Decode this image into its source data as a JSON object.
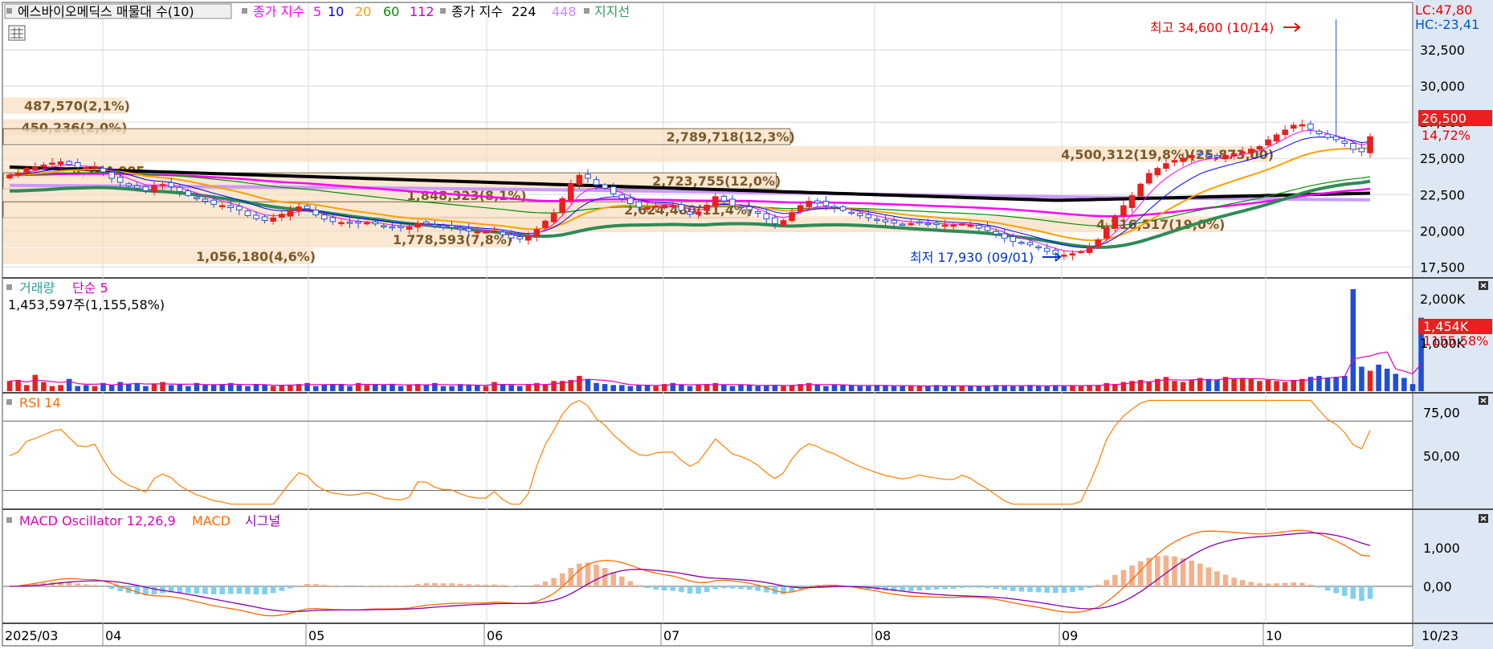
{
  "legend": {
    "stock": "에스바이오메딕스 매물대 수(10)",
    "ma_label": "종가 지수",
    "ma_periods": [
      {
        "v": "5",
        "color": "#ff00ff"
      },
      {
        "v": "10",
        "color": "#0000ff"
      },
      {
        "v": "20",
        "color": "#ffa000"
      },
      {
        "v": "60",
        "color": "#009000"
      },
      {
        "v": "112",
        "color": "#cc00cc"
      }
    ],
    "long_label": "종가 지수",
    "long_periods": [
      {
        "v": "224",
        "color": "#000000"
      },
      {
        "v": "448",
        "color": "#cc88ff"
      }
    ],
    "support": "지지선"
  },
  "right_info": {
    "lc": "LC:47,80",
    "hc": "HC:-23,41"
  },
  "price_badge": {
    "price": "26,500",
    "pct": "14,72%"
  },
  "price_annotations": {
    "high": "최고 34,600 (10/14)",
    "low": "최저 17,930 (09/01)"
  },
  "volume_panel": {
    "title": "거래량",
    "ma": "단순 5",
    "current": "1,453,597주(1,155,58%)",
    "badge_value": "1,454K",
    "badge_pct": "1155,58%"
  },
  "rsi_panel": {
    "title": "RSI 14"
  },
  "macd_panel": {
    "title": "MACD Oscillator 12,26,9",
    "macd": "MACD",
    "signal": "시그널"
  },
  "chart_data": {
    "type": "candlestick",
    "x_labels": [
      "2025/03",
      "04",
      "05",
      "06",
      "07",
      "08",
      "09",
      "10",
      "10/23"
    ],
    "price_axis": {
      "ylim": [
        16800,
        35500
      ],
      "ticks": [
        "17,500",
        "20,000",
        "22,500",
        "25,000",
        "27,500",
        "30,000",
        "32,500"
      ]
    },
    "high": {
      "value": 34600,
      "date": "10/14"
    },
    "low": {
      "value": 17930,
      "date": "09/01"
    },
    "last_close": 26500,
    "volume_profile": [
      {
        "price": 28650,
        "label": "487,570(2,1%)",
        "len": 0.087
      },
      {
        "price": 27150,
        "label": "450,236(2,0%)",
        "len": 0.085
      },
      {
        "price": 26500,
        "label": "2,789,718(12,3%)",
        "len": 0.56
      },
      {
        "price": 25300,
        "label": "4,500,312(19,8%)(25,873,00)",
        "len": 0.9
      },
      {
        "price": 24150,
        "label": "4,764,005",
        "len": 0.1
      },
      {
        "price": 23450,
        "label": "2,723,755(12,0%)",
        "len": 0.55
      },
      {
        "price": 22450,
        "label": "1,848,323(8,1%)",
        "len": 0.37
      },
      {
        "price": 21450,
        "label": "2,624,480(11,4%)",
        "len": 0.53
      },
      {
        "price": 20450,
        "label": "4,316,517(19,0%)",
        "len": 0.866
      },
      {
        "price": 19400,
        "label": "1,778,593(7,8%)",
        "len": 0.36
      },
      {
        "price": 18250,
        "label": "1,056,180(4,6%)",
        "len": 0.22
      }
    ],
    "volume_axis": {
      "ticks": [
        "1,000K",
        "2,000K"
      ]
    },
    "rsi_axis": {
      "ticks": [
        "50,00",
        "75,00"
      ],
      "upper": 70,
      "lower": 30
    },
    "macd_axis": {
      "ticks": [
        "0,00",
        "1,000"
      ]
    },
    "closes": [
      23850,
      23960,
      24310,
      24410,
      24540,
      24680,
      24760,
      24580,
      24390,
      24370,
      24440,
      24070,
      23620,
      23350,
      23110,
      22950,
      22770,
      23090,
      23200,
      23050,
      22710,
      22440,
      22210,
      22040,
      21830,
      21740,
      21600,
      21440,
      21050,
      20840,
      20710,
      20890,
      21140,
      21400,
      21650,
      21530,
      21100,
      20810,
      20640,
      20570,
      20510,
      20530,
      20560,
      20480,
      20310,
      20240,
      20210,
      20250,
      20510,
      20490,
      20320,
      20240,
      20230,
      20090,
      19980,
      19930,
      19930,
      20010,
      19730,
      19500,
      19430,
      19600,
      20090,
      20670,
      21240,
      22220,
      23210,
      23830,
      23630,
      23180,
      22940,
      22550,
      22230,
      21880,
      21630,
      21580,
      21710,
      21750,
      21740,
      21410,
      21140,
      21300,
      21770,
      22360,
      22060,
      21730,
      21620,
      21450,
      21210,
      20830,
      20490,
      20700,
      21260,
      21740,
      22040,
      21920,
      21730,
      21610,
      21410,
      21230,
      21040,
      20900,
      20750,
      20620,
      20540,
      20460,
      20500,
      20560,
      20490,
      20440,
      20400,
      20390,
      20470,
      20380,
      20190,
      20020,
      19770,
      19480,
      19260,
      19140,
      19030,
      18820,
      18580,
      18390,
      18320,
      18420,
      18570,
      18900,
      19370,
      20230,
      20980,
      21730,
      22430,
      23220,
      23960,
      24310,
      24640,
      24860,
      25020,
      25210,
      25300,
      25150,
      25090,
      25210,
      25330,
      25450,
      25640,
      25820,
      26280,
      26620,
      26960,
      27290,
      27330,
      27010,
      26700,
      26440,
      26290,
      26040,
      25620,
      25460,
      26500
    ],
    "volumes": [
      0.1,
      0.11,
      0.06,
      0.16,
      0.09,
      0.05,
      0.06,
      0.12,
      0.05,
      0.06,
      0.05,
      0.08,
      0.06,
      0.09,
      0.07,
      0.08,
      0.05,
      0.07,
      0.09,
      0.06,
      0.07,
      0.05,
      0.08,
      0.06,
      0.06,
      0.07,
      0.08,
      0.06,
      0.05,
      0.07,
      0.06,
      0.05,
      0.06,
      0.06,
      0.07,
      0.08,
      0.05,
      0.06,
      0.07,
      0.07,
      0.05,
      0.08,
      0.06,
      0.07,
      0.06,
      0.07,
      0.05,
      0.06,
      0.07,
      0.06,
      0.08,
      0.05,
      0.05,
      0.07,
      0.06,
      0.06,
      0.05,
      0.09,
      0.07,
      0.06,
      0.05,
      0.06,
      0.08,
      0.07,
      0.1,
      0.1,
      0.11,
      0.15,
      0.12,
      0.08,
      0.07,
      0.06,
      0.06,
      0.05,
      0.06,
      0.06,
      0.05,
      0.07,
      0.08,
      0.06,
      0.05,
      0.06,
      0.07,
      0.08,
      0.06,
      0.05,
      0.06,
      0.06,
      0.05,
      0.06,
      0.06,
      0.05,
      0.06,
      0.07,
      0.08,
      0.06,
      0.05,
      0.06,
      0.06,
      0.06,
      0.05,
      0.05,
      0.06,
      0.06,
      0.05,
      0.05,
      0.05,
      0.05,
      0.05,
      0.06,
      0.05,
      0.05,
      0.05,
      0.05,
      0.05,
      0.05,
      0.06,
      0.06,
      0.05,
      0.05,
      0.06,
      0.05,
      0.05,
      0.06,
      0.05,
      0.06,
      0.05,
      0.06,
      0.06,
      0.08,
      0.07,
      0.09,
      0.1,
      0.11,
      0.09,
      0.12,
      0.14,
      0.1,
      0.09,
      0.11,
      0.13,
      0.12,
      0.11,
      0.14,
      0.12,
      0.13,
      0.12,
      0.1,
      0.11,
      0.1,
      0.09,
      0.11,
      0.12,
      0.14,
      0.15,
      0.13,
      0.14,
      0.15,
      1.0,
      0.24,
      0.2,
      0.26,
      0.22,
      0.17,
      0.13,
      0.07,
      0.72
    ]
  }
}
